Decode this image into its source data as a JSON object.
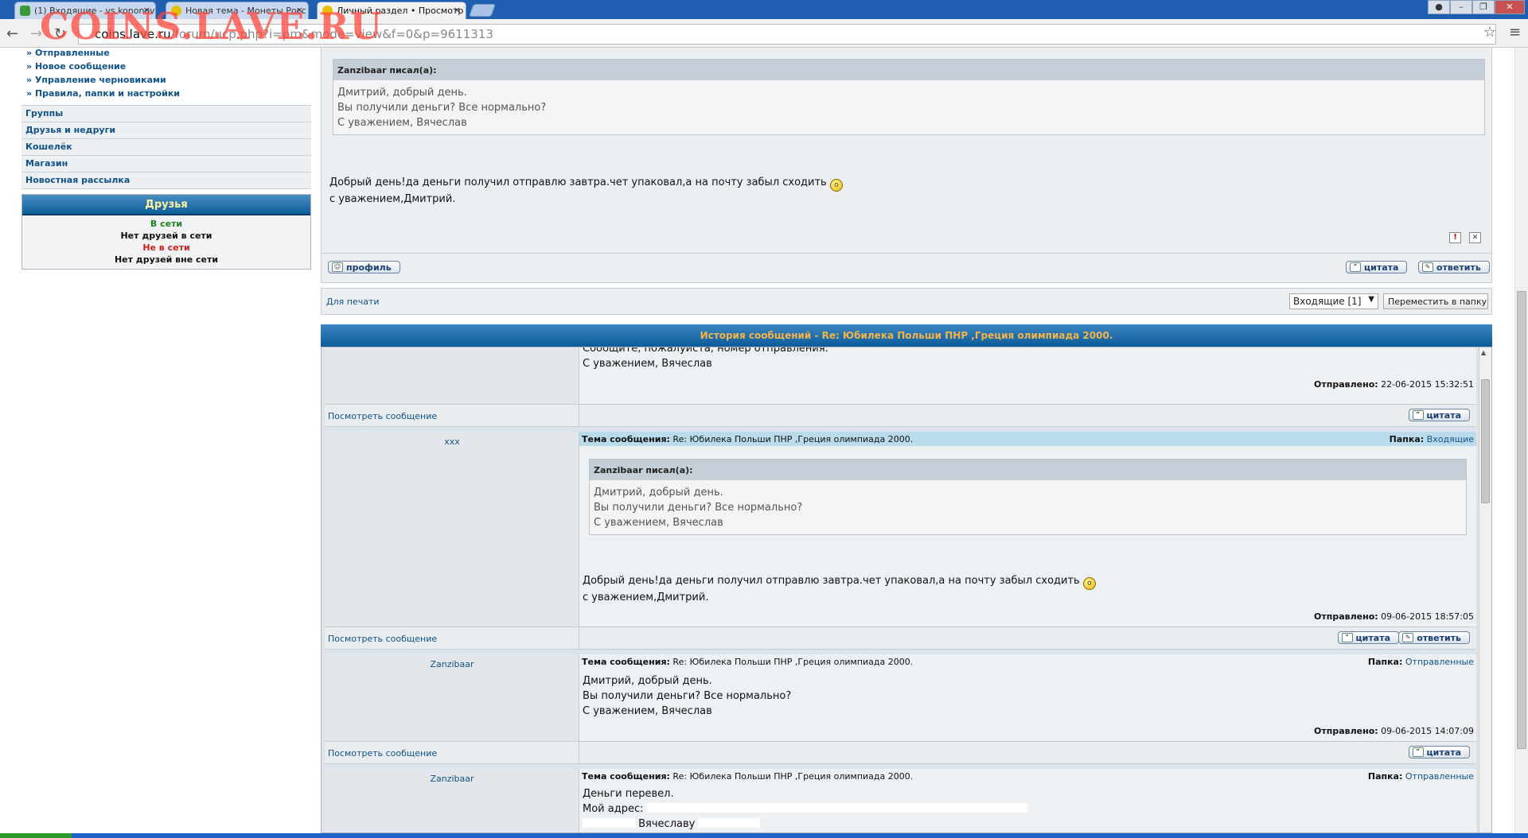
{
  "browser": {
    "tabs": [
      {
        "label": "(1) Входящие - vs.kononov",
        "active": false
      },
      {
        "label": "Новая тема - Монеты Росс",
        "active": false
      },
      {
        "label": "Личный раздел • Просмотр",
        "active": true
      }
    ],
    "tab_close": "×",
    "url_host": "coins.lave.ru",
    "url_path": "/forum/ucp.php?i=pm&mode=view&f=0&p=9611313",
    "watermark": "COINS.LAVE.RU",
    "back": "←",
    "forward": "→",
    "reload": "↻",
    "star": "☆",
    "menu": "≡"
  },
  "sidebar": {
    "pm_links": [
      "Отправленные",
      "Новое сообщение",
      "Управление черновиками",
      "Правила, папки и настройки"
    ],
    "bullet": "»",
    "menu": [
      "Группы",
      "Друзья и недруги",
      "Кошелёк",
      "Магазин",
      "Новостная рассылка"
    ],
    "friends": {
      "title": "Друзья",
      "online_label": "В сети",
      "online_none": "Нет друзей в сети",
      "offline_label": "Не в сети",
      "offline_none": "Нет друзей вне сети"
    }
  },
  "message": {
    "quote_author": "Zanzibaar писал(а):",
    "quote_lines": [
      "Дмитрий, добрый день.",
      "Вы получили деньги? Все нормально?",
      "С уважением, Вячеслав"
    ],
    "body_line1": "Добрый день!да деньги получил отправлю завтра.чет упаковал,а на почту забыл сходить",
    "body_line2": "с уважением,Дмитрий.",
    "report_icon": "!",
    "delete_icon": "✕",
    "profile_btn": "профиль",
    "quote_btn": "цитата",
    "reply_btn": "ответить"
  },
  "toolbar": {
    "print_link": "Для печати",
    "folder_select": "Входящие [1]",
    "move_btn": "Переместить в папку"
  },
  "history": {
    "title": "История сообщений - Re: Юбилека Польши ПНР ,Греция олимпиада 2000.",
    "subject_label": "Тема сообщения:",
    "subject": "Re: Юбилека Польши ПНР ,Греция олимпиада 2000.",
    "folder_label": "Папка:",
    "sent_label": "Отправлено:",
    "view_link": "Посмотреть сообщение",
    "quote_btn": "цитата",
    "reply_btn": "ответить",
    "entries": [
      {
        "lines": [
          "Сообщите, пожалуйста, номер отправления.",
          "С уважением, Вячеслав"
        ],
        "sent": "22-06-2015 15:32:51"
      },
      {
        "author": "xxx",
        "folder": "Входящие",
        "quote_author": "Zanzibaar писал(а):",
        "quote_lines": [
          "Дмитрий, добрый день.",
          "Вы получили деньги? Все нормально?",
          "С уважением, Вячеслав"
        ],
        "lines": [
          "Добрый день!да деньги получил отправлю завтра.чет упаковал,а на почту забыл сходить",
          "с уважением,Дмитрий."
        ],
        "sent": "09-06-2015 18:57:05"
      },
      {
        "author": "Zanzibaar",
        "folder": "Отправленные",
        "lines": [
          "Дмитрий, добрый день.",
          "Вы получили деньги? Все нормально?",
          "С уважением, Вячеслав"
        ],
        "sent": "09-06-2015 14:07:09"
      },
      {
        "author": "Zanzibaar",
        "folder": "Отправленные",
        "lines": [
          "Деньги перевел.",
          "Мой адрес:",
          "Вячеславу"
        ]
      }
    ]
  }
}
